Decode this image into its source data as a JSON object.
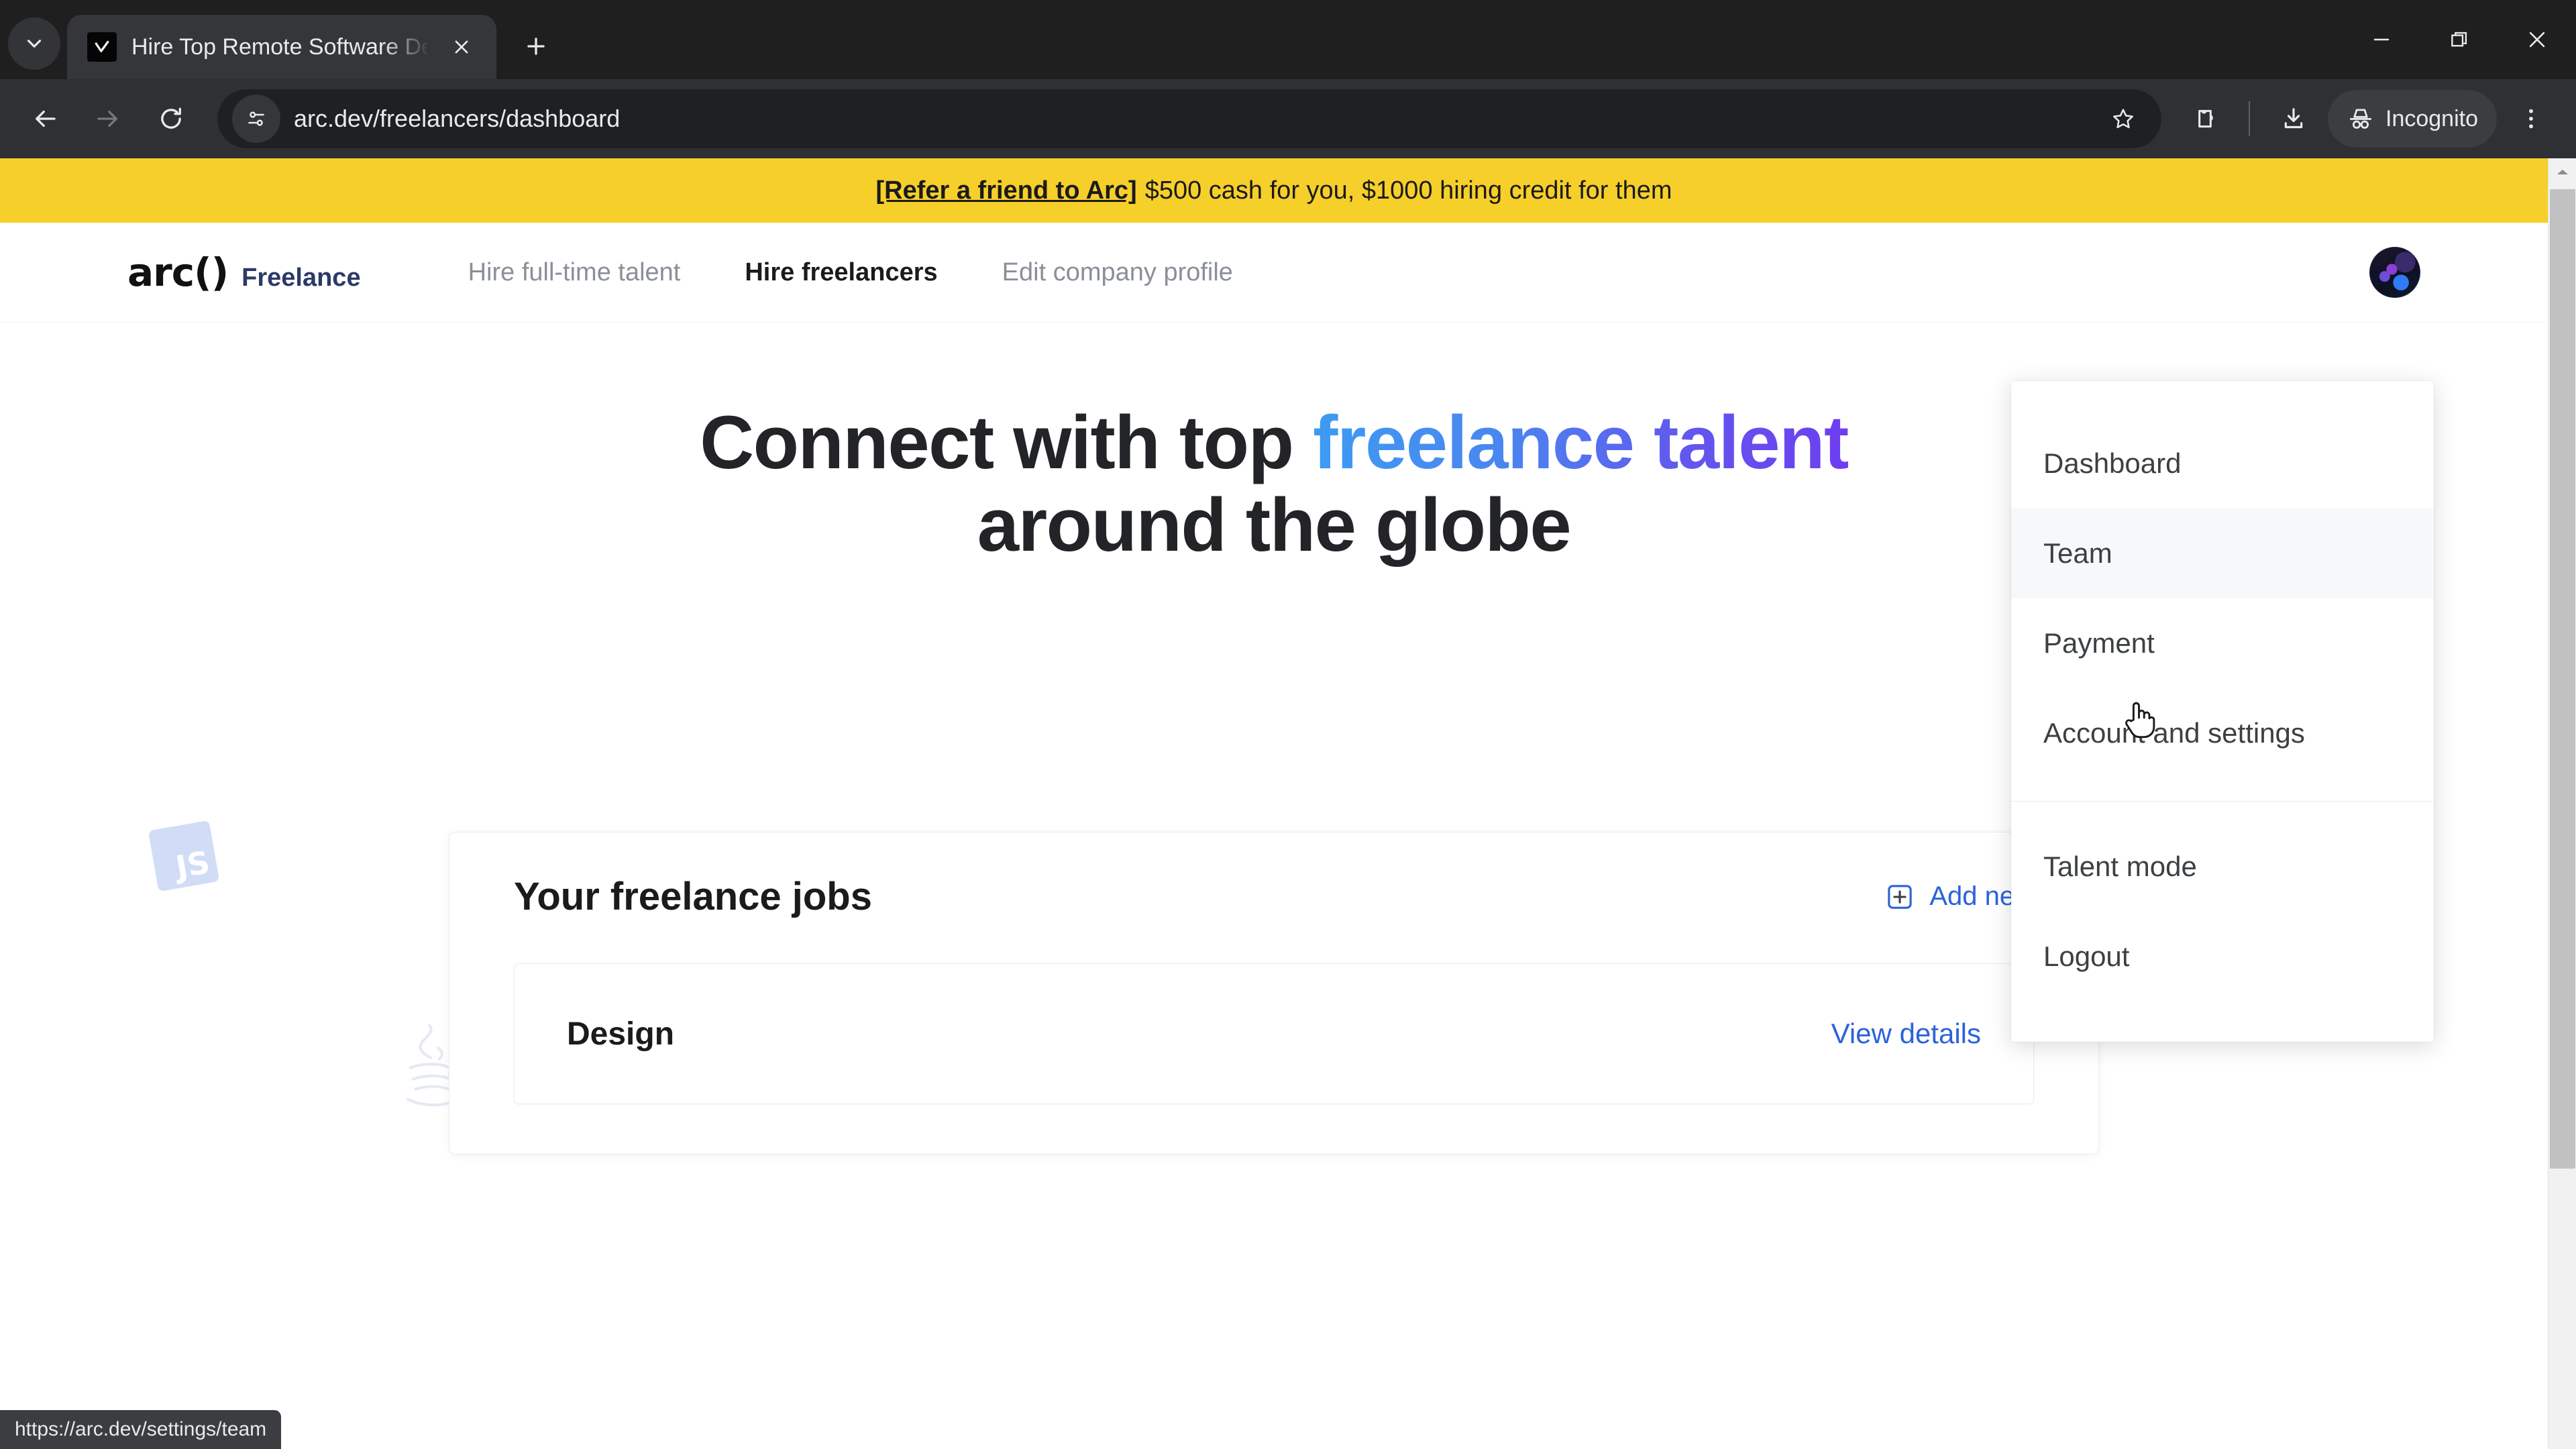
{
  "browser": {
    "tab": {
      "title": "Hire Top Remote Software Deve",
      "favicon_name": "arc-favicon"
    },
    "new_tab_label": "+",
    "url": "arc.dev/freelancers/dashboard",
    "profile_label": "Incognito",
    "icons": {
      "tab_list": "chevron-down-icon",
      "back": "back-arrow-icon",
      "forward": "forward-arrow-icon",
      "reload": "reload-icon",
      "site_info": "site-settings-icon",
      "bookmark": "star-icon",
      "extensions": "extensions-icon",
      "downloads": "download-icon",
      "incognito": "incognito-hat-icon",
      "menu": "three-dot-menu-icon",
      "minimize": "minimize-icon",
      "maximize": "maximize-restore-icon",
      "close": "close-icon"
    },
    "status_url": "https://arc.dev/settings/team"
  },
  "banner": {
    "link_text": "[Refer a friend to Arc]",
    "rest_text": "$500 cash for you, $1000 hiring credit for them",
    "background_color": "#f7cf2b"
  },
  "sitenav": {
    "logo_mark": "arc()",
    "logo_sub": "Freelance",
    "links": [
      {
        "label": "Hire full-time talent",
        "active": false
      },
      {
        "label": "Hire freelancers",
        "active": true
      },
      {
        "label": "Edit company profile",
        "active": false
      }
    ],
    "avatar_name": "user-avatar"
  },
  "hero": {
    "line1_plain": "Connect with top ",
    "line1_gradient": "freelance talent",
    "line2": "around the globe",
    "gradient_from": "#3d9bf2",
    "gradient_to": "#6d3ef0",
    "decorations": [
      {
        "name": "javascript-logo",
        "label": "JS"
      },
      {
        "name": "java-logo",
        "label": "Java"
      }
    ]
  },
  "jobs": {
    "title": "Your freelance jobs",
    "add_new_label": "Add new",
    "add_new_color": "#2b63d9",
    "rows": [
      {
        "name": "Design",
        "action_label": "View details"
      }
    ]
  },
  "user_menu": {
    "items": [
      {
        "label": "Dashboard",
        "hover": false,
        "separator_after": false
      },
      {
        "label": "Team",
        "hover": true,
        "separator_after": false
      },
      {
        "label": "Payment",
        "hover": false,
        "separator_after": false
      },
      {
        "label": "Account and settings",
        "hover": false,
        "separator_after": true
      },
      {
        "label": "Talent mode",
        "hover": false,
        "separator_after": false
      },
      {
        "label": "Logout",
        "hover": false,
        "separator_after": false
      }
    ]
  },
  "scrollbar": {
    "up_arrow": "scroll-up-arrow-icon"
  }
}
